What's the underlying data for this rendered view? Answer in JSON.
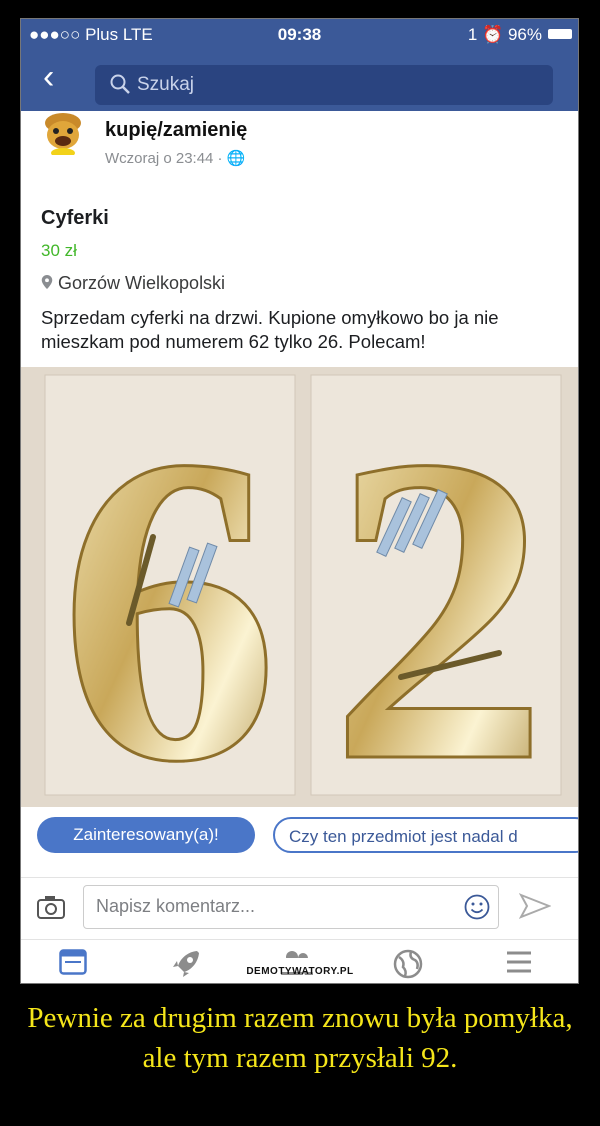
{
  "statusbar": {
    "carrier": "●●●○○ Plus  LTE",
    "time": "09:38",
    "battery": "1 ⏰ 96%"
  },
  "navbar": {
    "back": "‹",
    "search_placeholder": "Szukaj"
  },
  "post": {
    "poster": "kupię/zamienię",
    "timestamp": "Wczoraj o 23:44 · 🌐",
    "title": "Cyferki",
    "price": "30 zł",
    "location": "Gorzów Wielkopolski",
    "description": "Sprzedam cyferki na drzwi. Kupione omyłkowo bo ja nie mieszkam pod numerem 62 tylko 26. Polecam!",
    "photo_digits": [
      "6",
      "2"
    ]
  },
  "actions": {
    "interested": "Zainteresowany(a)!",
    "available": "Czy ten przedmiot jest nadal d"
  },
  "comment": {
    "placeholder": "Napisz komentarz..."
  },
  "tabs": [
    "news-feed-icon",
    "rocket-icon",
    "friends-icon",
    "globe-icon",
    "menu-icon"
  ],
  "watermark": "DEMOTYWATORY.PL",
  "caption": "Pewnie za drugim razem znowu była pomyłka, ale tym razem przysłali 92.",
  "colors": {
    "fb_blue": "#3b5998",
    "price_green": "#42b72a",
    "caption_yellow": "#f5e61a"
  }
}
